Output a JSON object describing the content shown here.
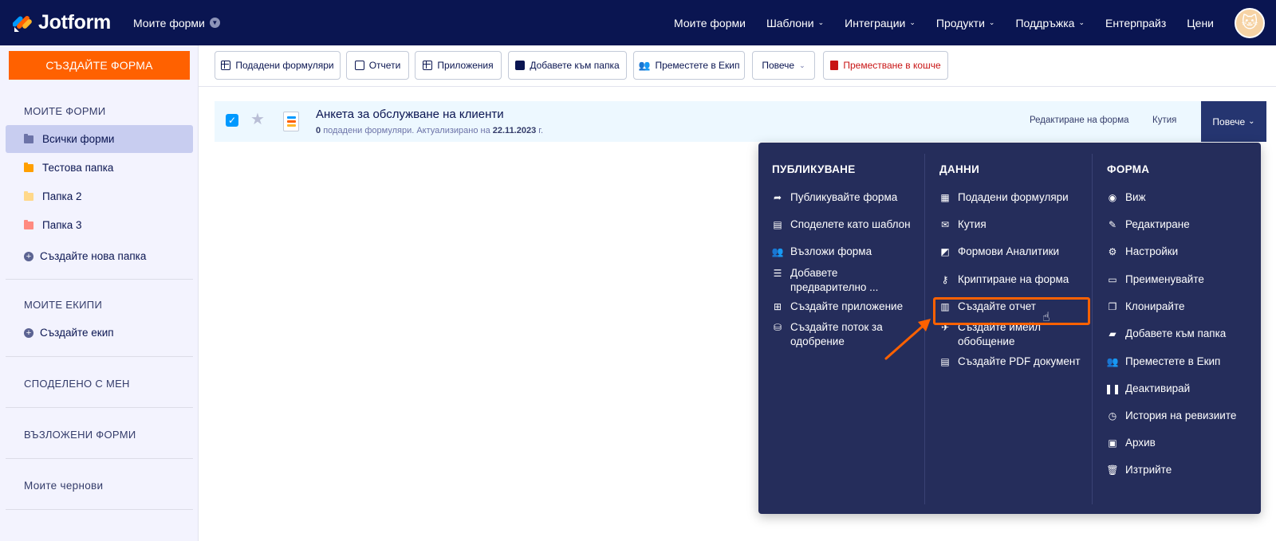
{
  "nav": {
    "logo_text": "Jotform",
    "my_forms": "Моите форми",
    "items": [
      {
        "label": "Моите форми",
        "chevron": false
      },
      {
        "label": "Шаблони",
        "chevron": true
      },
      {
        "label": "Интеграции",
        "chevron": true
      },
      {
        "label": "Продукти",
        "chevron": true
      },
      {
        "label": "Поддръжка",
        "chevron": true
      },
      {
        "label": "Ентерпрайз",
        "chevron": false
      },
      {
        "label": "Цени",
        "chevron": false
      }
    ]
  },
  "sidebar": {
    "create_button": "СЪЗДАЙТЕ ФОРМА",
    "my_forms_header": "МОИТЕ ФОРМИ",
    "folders": [
      {
        "label": "Всички форми",
        "color": "#6c73a8"
      },
      {
        "label": "Тестова папка",
        "color": "#ff9f00"
      },
      {
        "label": "Папка 2",
        "color": "#ffd88a"
      },
      {
        "label": "Папка 3",
        "color": "#ff8a80"
      }
    ],
    "new_folder": "Създайте нова папка",
    "teams_header": "МОИТЕ ЕКИПИ",
    "new_team": "Създайте екип",
    "shared_header": "СПОДЕЛЕНО С МЕН",
    "assigned_header": "ВЪЗЛОЖЕНИ ФОРМИ",
    "drafts": "Моите чернови"
  },
  "toolbar": {
    "submissions": "Подадени формуляри",
    "reports": "Отчети",
    "apps": "Приложения",
    "add_folder": "Добавете към папка",
    "move_team": "Преместете в Екип",
    "more": "Повече",
    "trash": "Преместване в кошче"
  },
  "form_row": {
    "title": "Анкета за обслужване на клиенти",
    "count": "0",
    "meta_mid": "подадени формуляри. Актуализирано на",
    "date": "22.11.2023",
    "meta_end": "г.",
    "edit": "Редактиране на форма",
    "inbox": "Кутия",
    "more": "Повече"
  },
  "dropdown": {
    "publish": {
      "header": "ПУБЛИКУВАНЕ",
      "items": [
        {
          "label": "Публикувайте форма",
          "icon": "share-arrow-icon"
        },
        {
          "label": "Споделете като шаблон",
          "icon": "template-icon"
        },
        {
          "label": "Възложи форма",
          "icon": "assign-users-icon"
        },
        {
          "label": "Добавете предварително ...",
          "icon": "prefill-icon"
        },
        {
          "label": "Създайте приложение",
          "icon": "app-icon"
        },
        {
          "label": "Създайте поток за одобрение",
          "icon": "approval-flow-icon"
        }
      ]
    },
    "data": {
      "header": "ДАННИ",
      "items": [
        {
          "label": "Подадени формуляри",
          "icon": "table-icon"
        },
        {
          "label": "Кутия",
          "icon": "inbox-icon"
        },
        {
          "label": "Формови Аналитики",
          "icon": "analytics-icon"
        },
        {
          "label": "Криптиране на форма",
          "icon": "key-icon"
        },
        {
          "label": "Създайте отчет",
          "icon": "report-icon"
        },
        {
          "label": "Създайте имейл обобщение",
          "icon": "send-icon"
        },
        {
          "label": "Създайте PDF документ",
          "icon": "pdf-icon"
        }
      ]
    },
    "form": {
      "header": "ФОРМА",
      "items": [
        {
          "label": "Виж",
          "icon": "eye-icon"
        },
        {
          "label": "Редактиране",
          "icon": "edit-icon"
        },
        {
          "label": "Настройки",
          "icon": "gear-icon"
        },
        {
          "label": "Преименувайте",
          "icon": "rename-icon"
        },
        {
          "label": "Клонирайте",
          "icon": "clone-icon"
        },
        {
          "label": "Добавете към папка",
          "icon": "folder-plus-icon"
        },
        {
          "label": "Преместете в Екип",
          "icon": "team-icon"
        },
        {
          "label": "Деактивирай",
          "icon": "pause-icon"
        },
        {
          "label": "История на ревизиите",
          "icon": "history-icon"
        },
        {
          "label": "Архив",
          "icon": "archive-icon"
        },
        {
          "label": "Изтрийте",
          "icon": "trash-icon"
        }
      ]
    }
  },
  "colors": {
    "nav_bg": "#0a1551",
    "accent": "#ff6100",
    "dropdown_bg": "#252d5b",
    "sidebar_bg": "#f3f3fe"
  }
}
